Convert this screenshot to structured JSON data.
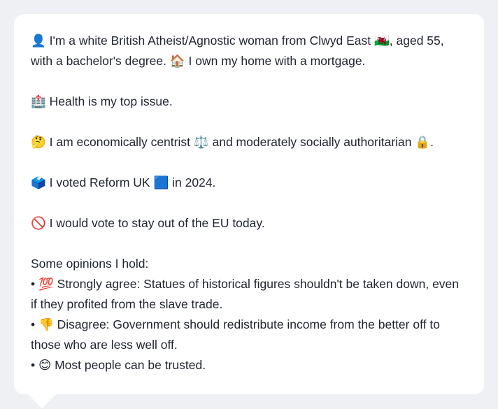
{
  "persona": {
    "intro": "👤 I'm a white British Atheist/Agnostic woman from Clwyd East 🏴󠁧󠁢󠁷󠁬󠁳󠁿, aged 55, with a bachelor's degree. 🏠 I own my home with a mortgage.",
    "health": "🏥 Health is my top issue.",
    "ideology": "🤔 I am economically centrist ⚖️ and moderately socially authoritarian 🔒.",
    "vote_2024": "🗳️ I voted Reform UK 🟦 in 2024.",
    "eu": "🚫 I would vote to stay out of the EU today."
  },
  "opinions": {
    "heading": "Some opinions I hold:",
    "items": [
      "• 💯 Strongly agree: Statues of historical figures shouldn't be taken down, even if they profited from the slave trade.",
      "• 👎 Disagree: Government should redistribute income from the better off to those who are less well off.",
      "• 😊 Most people can be trusted."
    ]
  }
}
